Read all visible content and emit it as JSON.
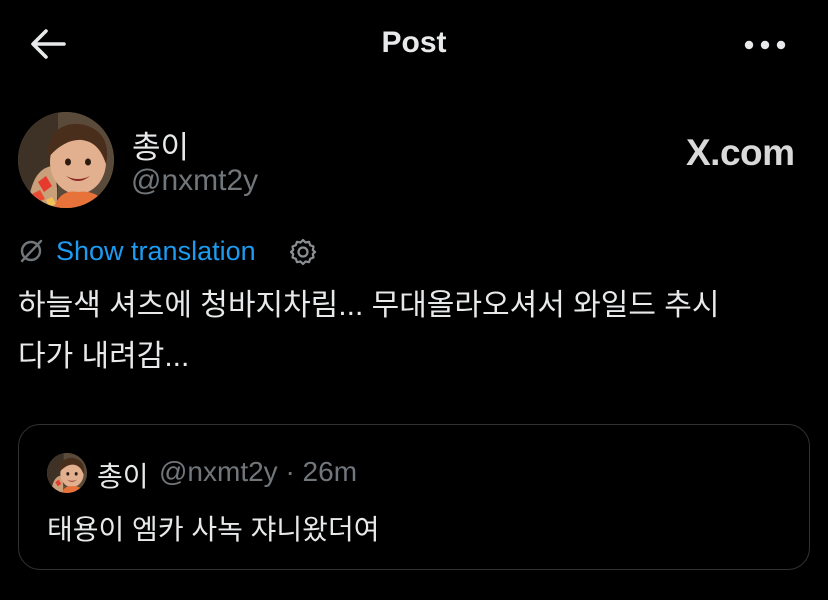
{
  "header": {
    "title": "Post",
    "back_icon": "arrow-left-icon",
    "more_icon": "more-horizontal-icon"
  },
  "author": {
    "display_name": "총이",
    "handle": "@nxmt2y",
    "brand_watermark": "X.com"
  },
  "translation": {
    "icon": "translate-icon",
    "link_text": "Show translation",
    "settings_icon": "gear-icon"
  },
  "post": {
    "lines": [
      "하늘색 셔츠에 청바지차림... 무대올라오셔서 와일드 추시",
      "다가 내려감..."
    ]
  },
  "quote": {
    "display_name": "총이",
    "meta": "@nxmt2y · 26m",
    "text": "태용이 엠카 사녹 쟈니왔더여"
  },
  "colors": {
    "background": "#000000",
    "text_primary": "#e7e9ea",
    "text_secondary": "#71767b",
    "link": "#1d9bf0",
    "border": "#2f3336"
  }
}
